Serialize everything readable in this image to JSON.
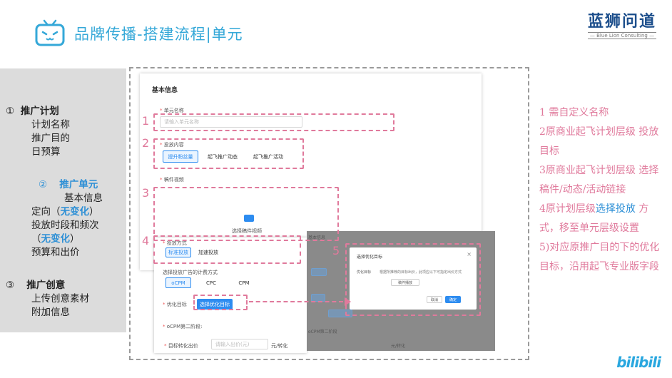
{
  "header": {
    "title": "品牌传播-搭建流程|单元",
    "brand_name": "蓝狮问道",
    "brand_sub": "— Blue Lion Consulting —",
    "tv_icon": "bilibili-tv-icon"
  },
  "left_panel": {
    "section1_num": "①",
    "section1_title": "推广计划",
    "section1_items": [
      "计划名称",
      "推广目的",
      "日预算"
    ],
    "section2_num": "②",
    "section2_title": "推广单元",
    "section2_item1": "基本信息",
    "section2_item2_pre": "定向（",
    "section2_item2_mark": "无变化",
    "section2_item2_post": "）",
    "section2_item3": "投放时段和频次",
    "section2_item4_pre": "（",
    "section2_item4_mark": "无变化",
    "section2_item4_post": "）",
    "section2_item5": "预算和出价",
    "section3_num": "③",
    "section3_title": "推广创意",
    "section3_items": [
      "上传创意素材",
      "附加信息"
    ]
  },
  "form": {
    "title": "基本信息",
    "unit_name_label": "单元名称",
    "unit_name_placeholder": "请输入单元名称",
    "content_label": "投放内容",
    "content_options": [
      "提升粉丝量",
      "起飞推广动态",
      "起飞推广活动"
    ],
    "content_selected": "提升粉丝量",
    "video_label": "稿件视频",
    "upload_text": "选择稿件视频",
    "delivery_label": "投放方式",
    "delivery_options": [
      "标准投放",
      "加速投放"
    ],
    "bid_method_label": "选择投放广告的计费方式",
    "bid_options": [
      "oCPM",
      "CPC",
      "CPM"
    ],
    "goal_label": "优化目标",
    "goal_button": "选择优化目标",
    "ocpm_stage_label": "oCPM第二阶段:",
    "target_cost_label": "目标转化出价",
    "target_cost_placeholder": "请输入出价(元)",
    "target_cost_unit": "元/转化"
  },
  "modal": {
    "title": "选择优化目标",
    "close": "×",
    "label": "优化目标",
    "desc": "根据所推荐的目标出价，此项应以下可指定出价方式",
    "option": "稿件播放",
    "cancel": "取消",
    "confirm": "确定"
  },
  "overlay_faint": {
    "text1": "基本信息",
    "text2": "oCPM第二阶段",
    "text3": "元/转化"
  },
  "markers": [
    "1",
    "2",
    "3",
    "4",
    "5"
  ],
  "notes": {
    "n1": "1    需自定义名称",
    "n2": "2原商业起飞计划层级 投放目标",
    "n3": "3原商业起飞计划层级 选择稿件/动态/活动链接",
    "n4_pre": "4原计划层级",
    "n4_mark": "选择投放",
    "n4_post": " 方式，移至单元层级设置",
    "n5": "5)对应原推广目的下的优化目标，沿用起飞专业版字段"
  },
  "footer": {
    "logo_text": "bilibili"
  },
  "colors": {
    "accent_blue": "#35a8d8",
    "pink_highlight": "#e07a9c",
    "brand_navy": "#1d4f8c",
    "button_blue": "#2d8cf0"
  }
}
